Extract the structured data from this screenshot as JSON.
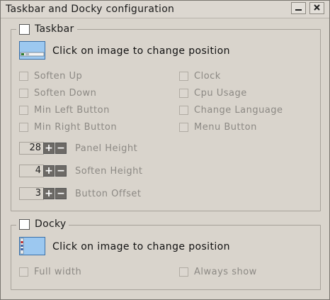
{
  "window": {
    "title": "Taskbar and Docky configuration",
    "buttons": {
      "minimize": "minimize",
      "close": "close"
    }
  },
  "taskbar": {
    "label": "Taskbar",
    "enabled": false,
    "position_text": "Click on image to change position",
    "options_left": [
      "Soften Up",
      "Soften Down",
      "Min Left Button",
      "Min Right Button"
    ],
    "options_right": [
      "Clock",
      "Cpu Usage",
      "Change Language",
      "Menu Button"
    ],
    "spinners": [
      {
        "value": "28",
        "label": "Panel Height"
      },
      {
        "value": "4",
        "label": "Soften Height"
      },
      {
        "value": "3",
        "label": "Button Offset"
      }
    ]
  },
  "docky": {
    "label": "Docky",
    "enabled": false,
    "position_text": "Click on image to change position",
    "options": [
      "Full width",
      "Always show"
    ]
  },
  "colors": {
    "accent": "#9cc8f0",
    "accent_border": "#3b70a8",
    "disabled_text": "#8c8984"
  }
}
